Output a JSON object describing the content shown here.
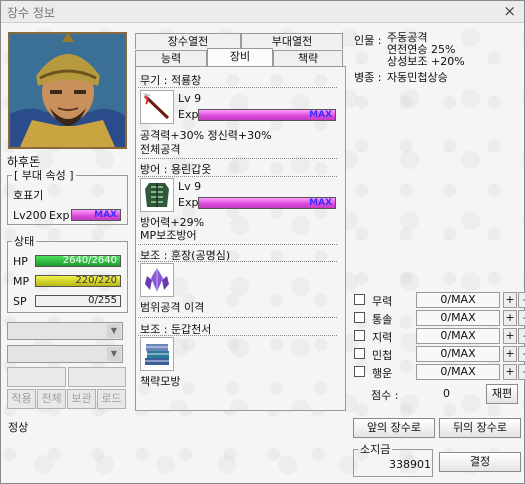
{
  "window": {
    "title": "장수 정보",
    "close_glyph": "×"
  },
  "general": {
    "name": "하후돈",
    "unit": {
      "legend": "[ 부대 속성 ]",
      "type": "호표기",
      "level_label": "Lv200",
      "exp_label": "Exp",
      "exp_bar_text": "MAX",
      "exp_fill": 1.0
    }
  },
  "status": {
    "legend": "상태",
    "hp": {
      "label": "HP",
      "text": "2640/2640",
      "fill": 1.0
    },
    "mp": {
      "label": "MP",
      "text": "220/220",
      "fill": 1.0
    },
    "sp": {
      "label": "SP",
      "text": "0/255",
      "fill": 0.0
    }
  },
  "lower_left_buttons": [
    "적용",
    "전체",
    "보관",
    "로드"
  ],
  "tabs": {
    "row1": [
      "장수열전",
      "부대열전"
    ],
    "row2": [
      "능력",
      "장비",
      "책략"
    ],
    "active": "장비"
  },
  "equipment": {
    "weapon": {
      "label": "무기 :  적룡창",
      "lv": "Lv 9",
      "exp_label": "Exp",
      "exp_text": "MAX",
      "exp_fill": 1.0,
      "line1": "공격력+30% 정신력+30%",
      "line2": "전체공격",
      "icon": "spear-icon"
    },
    "armor": {
      "label": "방어 :  용린갑옷",
      "lv": "Lv 9",
      "exp_label": "Exp",
      "exp_text": "MAX",
      "exp_fill": 1.0,
      "line1": "방어력+29%",
      "line2": "MP보조방어",
      "icon": "armor-icon"
    },
    "aux1": {
      "label": "보조 :  훈장(공명심)",
      "line1": "범위공격 이격",
      "icon": "crystal-icon"
    },
    "aux2": {
      "label": "보조 :  둔갑천서",
      "line1": "책략모방",
      "icon": "book-icon"
    }
  },
  "persona": {
    "personality_label": "인물 :",
    "personality": [
      "주동공격",
      "연전연승 25%",
      "상성보조 +20%"
    ],
    "branch_label": "병종 :",
    "branch": "자동민첩상승"
  },
  "stats": [
    {
      "name": "무력",
      "value": "0/MAX"
    },
    {
      "name": "통솔",
      "value": "0/MAX"
    },
    {
      "name": "지력",
      "value": "0/MAX"
    },
    {
      "name": "민첩",
      "value": "0/MAX"
    },
    {
      "name": "행운",
      "value": "0/MAX"
    }
  ],
  "points": {
    "label": "점수 :",
    "value": "0",
    "reset": "재편"
  },
  "nav": {
    "prev": "앞의 장수로",
    "next": "뒤의 장수로"
  },
  "money": {
    "legend": "소지금",
    "value": "338901",
    "confirm": "결정"
  },
  "statusbar": {
    "text": "정상"
  },
  "colors": {
    "hp": "#2fbf3f",
    "mp": "#d8d82a",
    "exp": "#e060e0",
    "exp_text": "#3b2cff"
  }
}
